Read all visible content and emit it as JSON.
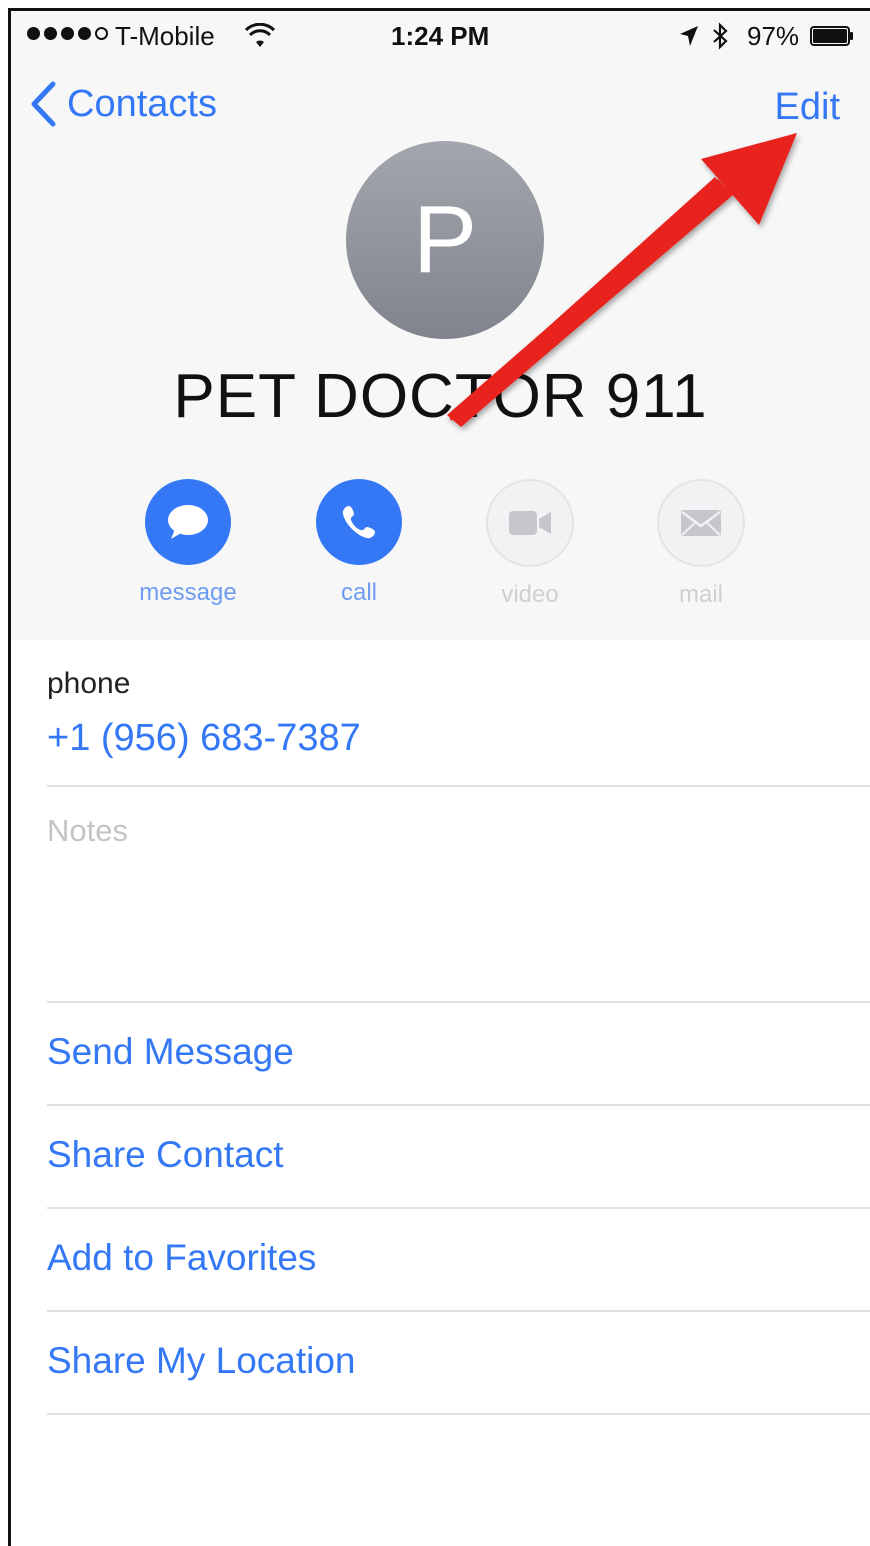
{
  "status_bar": {
    "carrier": "T-Mobile",
    "time": "1:24 PM",
    "battery_percent": "97%",
    "signal_bars_filled": 4,
    "signal_bars_total": 5
  },
  "nav": {
    "back_label": "Contacts",
    "edit_label": "Edit"
  },
  "contact": {
    "initial": "P",
    "name": "PET DOCTOR 911"
  },
  "actions": {
    "message": "message",
    "call": "call",
    "video": "video",
    "mail": "mail"
  },
  "details": {
    "phone_label": "phone",
    "phone_value": "+1 (956) 683-7387",
    "notes_placeholder": "Notes"
  },
  "links": {
    "send_message": "Send Message",
    "share_contact": "Share Contact",
    "add_to_favorites": "Add to Favorites",
    "share_my_location": "Share My Location"
  },
  "colors": {
    "accent": "#3478f6",
    "annotation_arrow": "#e8231b"
  },
  "annotation": {
    "icon": "red-arrow-icon"
  }
}
